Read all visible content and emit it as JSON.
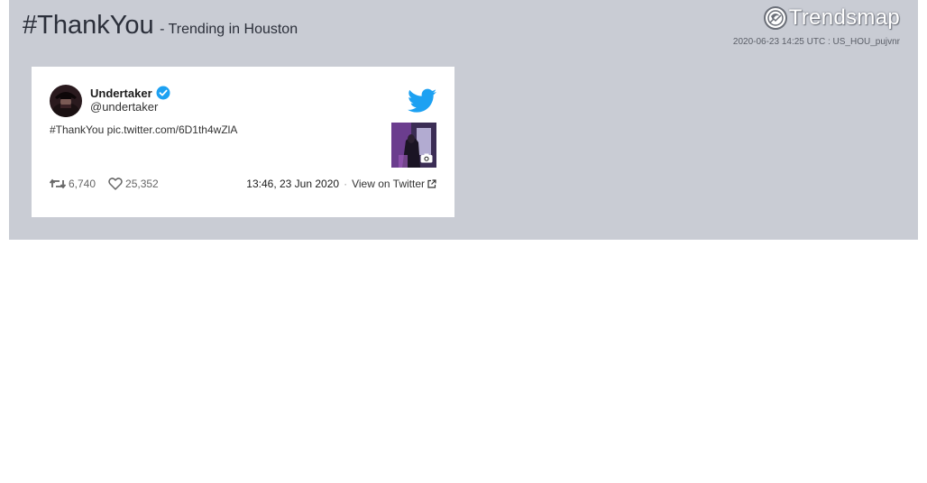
{
  "header": {
    "hashtag": "#ThankYou",
    "subtitle": "- Trending in Houston",
    "brand": "Trendsmap",
    "meta": "2020-06-23 14:25 UTC : US_HOU_pujvnr"
  },
  "tweet": {
    "author_name": "Undertaker",
    "author_handle": "@undertaker",
    "text": "#ThankYou pic.twitter.com/6D1th4wZlA",
    "retweets": "6,740",
    "likes": "25,352",
    "timestamp": "13:46, 23 Jun 2020",
    "separator": "·",
    "view_link": "View on Twitter"
  },
  "icons": {
    "brand": "trendsmap-logo-icon",
    "verified": "verified-badge-icon",
    "twitter": "twitter-bird-icon",
    "retweet": "retweet-icon",
    "like": "heart-icon",
    "camera": "camera-icon",
    "external": "external-link-icon"
  },
  "colors": {
    "panel": "#c9ccd4",
    "twitter_blue": "#1da1f2",
    "text": "#333333"
  }
}
